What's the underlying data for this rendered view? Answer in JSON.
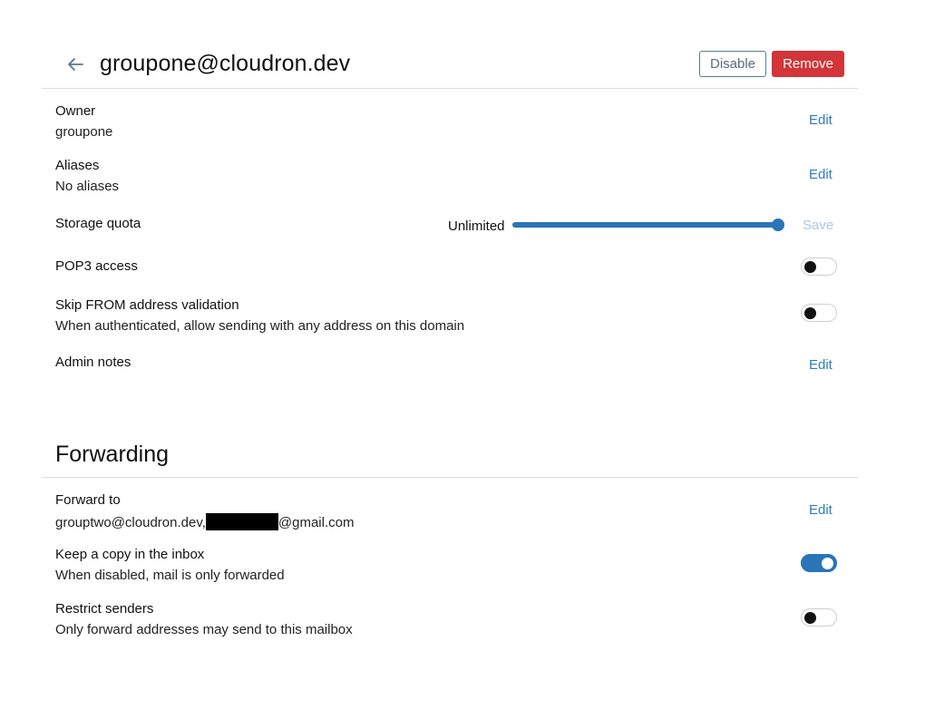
{
  "header": {
    "title": "groupone@cloudron.dev",
    "back_icon": "arrow-left-icon",
    "disable_label": "Disable",
    "remove_label": "Remove"
  },
  "owner": {
    "label": "Owner",
    "value": "groupone",
    "edit_label": "Edit"
  },
  "aliases": {
    "label": "Aliases",
    "value": "No aliases",
    "edit_label": "Edit"
  },
  "storage_quota": {
    "label": "Storage quota",
    "value_text": "Unlimited",
    "slider_level": 1.0,
    "save_label": "Save"
  },
  "pop3": {
    "label": "POP3 access",
    "enabled": false
  },
  "skip_from": {
    "label": "Skip FROM address validation",
    "description": "When authenticated, allow sending with any address on this domain",
    "enabled": false
  },
  "admin_notes": {
    "label": "Admin notes",
    "edit_label": "Edit"
  },
  "forwarding": {
    "section_title": "Forwarding",
    "forward_to": {
      "label": "Forward to",
      "value_prefix": "grouptwo@cloudron.dev,",
      "value_suffix": "@gmail.com",
      "edit_label": "Edit"
    },
    "keep_copy": {
      "label": "Keep a copy in the inbox",
      "description": "When disabled, mail is only forwarded",
      "enabled": true
    },
    "restrict_senders": {
      "label": "Restrict senders",
      "description": "Only forward addresses may send to this mailbox",
      "enabled": false
    }
  },
  "colors": {
    "accent": "#2a74b8",
    "danger": "#d2353a",
    "link": "#2f7bc1"
  }
}
